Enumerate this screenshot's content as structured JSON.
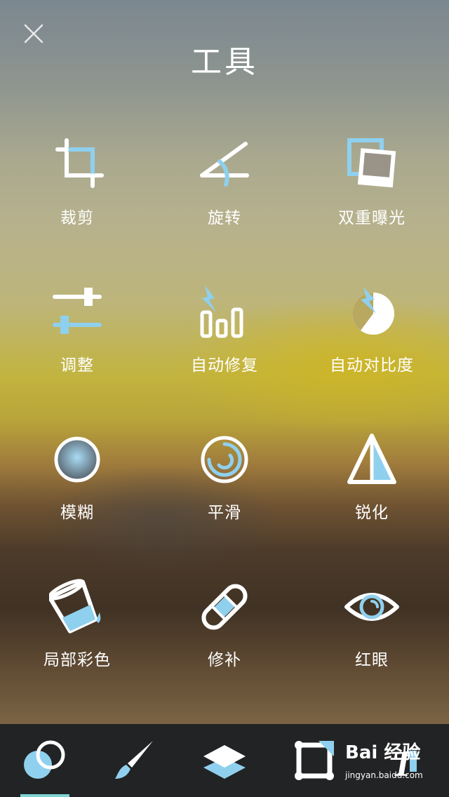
{
  "header": {
    "title": "工具"
  },
  "tools": [
    {
      "label": "裁剪"
    },
    {
      "label": "旋转"
    },
    {
      "label": "双重曝光"
    },
    {
      "label": "调整"
    },
    {
      "label": "自动修复"
    },
    {
      "label": "自动对比度"
    },
    {
      "label": "模糊"
    },
    {
      "label": "平滑"
    },
    {
      "label": "锐化"
    },
    {
      "label": "局部彩色"
    },
    {
      "label": "修补"
    },
    {
      "label": "红眼"
    }
  ],
  "bottom_bar": {
    "tabs": [
      {
        "icon": "tools-circles-icon",
        "active": true
      },
      {
        "icon": "brush-icon",
        "active": false
      },
      {
        "icon": "layers-icon",
        "active": false
      },
      {
        "icon": "frame-icon",
        "active": false
      },
      {
        "icon": "text-icon",
        "active": false
      }
    ]
  },
  "watermark": {
    "brand": "Bai 经验",
    "url": "jingyan.baidu.com"
  },
  "colors": {
    "accent_blue": "#8fd0ee",
    "icon_white": "#ffffff",
    "tab_underline": "#7fd3d3",
    "bottom_bg": "#222324"
  }
}
